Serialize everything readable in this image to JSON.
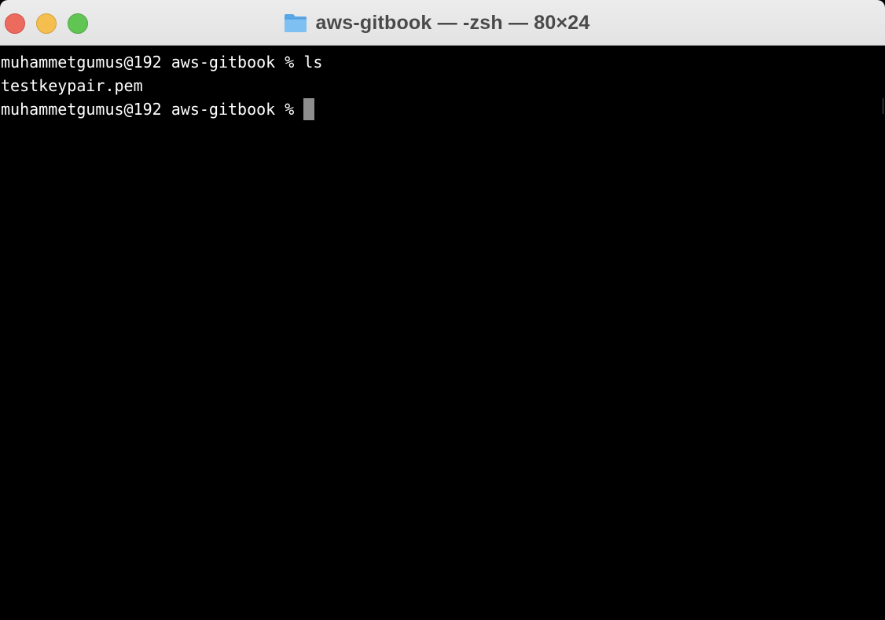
{
  "window": {
    "title": "aws-gitbook — -zsh — 80×24",
    "title_icon": "folder-icon"
  },
  "terminal": {
    "lines": [
      {
        "prompt": "muhammetgumus@192 aws-gitbook %",
        "command": "ls"
      },
      {
        "output": "testkeypair.pem"
      },
      {
        "prompt": "muhammetgumus@192 aws-gitbook %",
        "command": ""
      }
    ]
  },
  "colors": {
    "close": "#ec6a5e",
    "minimize": "#f4bf4f",
    "zoom": "#61c554",
    "terminal_bg": "#000000",
    "terminal_fg": "#ffffff",
    "cursor": "#8e8e8e"
  }
}
